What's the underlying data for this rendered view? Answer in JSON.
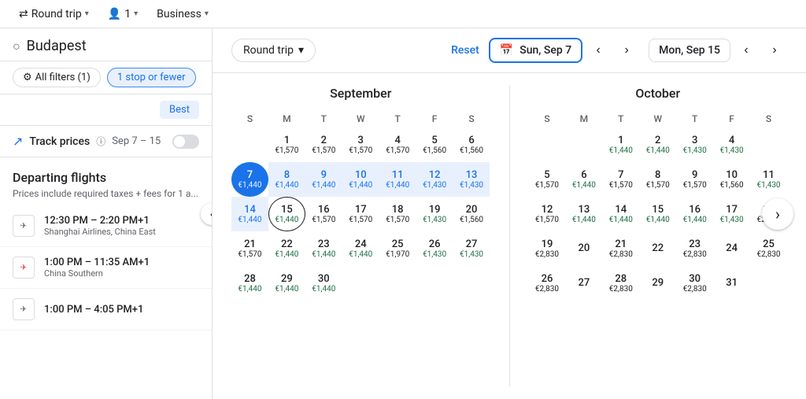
{
  "topbar": {
    "trip_type": "Round trip",
    "passengers": "1",
    "cabin": "Business",
    "chevron": "▾"
  },
  "left": {
    "search_placeholder": "Budapest",
    "filter_all": "All filters (1)",
    "filter_stops": "1 stop or fewer",
    "sort_label": "Best",
    "track_label": "Track prices",
    "track_info_icon": "ⓘ",
    "track_dates": "Sep 7 – 15",
    "departing_title": "Departing flights",
    "departing_sub": "Prices include required taxes + fees for 1 a...",
    "flights": [
      {
        "times": "12:30 PM – 2:20 PM+1",
        "airline": "Shanghai Airlines, China East"
      },
      {
        "times": "1:00 PM – 11:35 AM+1",
        "airline": "China Southern"
      },
      {
        "times": "1:00 PM – 4:05 PM+1",
        "airline": ""
      }
    ]
  },
  "calendar": {
    "trip_selector": "Round trip",
    "reset_label": "Reset",
    "selected_date": "Sun, Sep 7",
    "end_date": "Mon, Sep 15",
    "calendar_icon": "📅",
    "september": {
      "title": "September",
      "headers": [
        "S",
        "M",
        "T",
        "W",
        "T",
        "F",
        "S"
      ],
      "rows": [
        [
          {
            "day": "",
            "price": ""
          },
          {
            "day": "1",
            "price": "€1,570",
            "type": "normal"
          },
          {
            "day": "2",
            "price": "€1,570",
            "type": "normal"
          },
          {
            "day": "3",
            "price": "€1,570",
            "type": "normal"
          },
          {
            "day": "4",
            "price": "€1,570",
            "type": "normal"
          },
          {
            "day": "5",
            "price": "€1,560",
            "type": "normal"
          },
          {
            "day": "6",
            "price": "€1,560",
            "type": "normal"
          }
        ],
        [
          {
            "day": "7",
            "price": "€1,440",
            "type": "selected"
          },
          {
            "day": "8",
            "price": "€1,440",
            "type": "range"
          },
          {
            "day": "9",
            "price": "€1,440",
            "type": "range"
          },
          {
            "day": "10",
            "price": "€1,440",
            "type": "range"
          },
          {
            "day": "11",
            "price": "€1,440",
            "type": "range"
          },
          {
            "day": "12",
            "price": "€1,430",
            "type": "range"
          },
          {
            "day": "13",
            "price": "€1,430",
            "type": "range"
          }
        ],
        [
          {
            "day": "14",
            "price": "€1,440",
            "type": "range"
          },
          {
            "day": "15",
            "price": "€1,440",
            "type": "range-end"
          },
          {
            "day": "16",
            "price": "€1,570",
            "type": "normal"
          },
          {
            "day": "17",
            "price": "€1,570",
            "type": "normal"
          },
          {
            "day": "18",
            "price": "€1,570",
            "type": "normal"
          },
          {
            "day": "19",
            "price": "€1,430",
            "type": "green"
          },
          {
            "day": "20",
            "price": "€1,560",
            "type": "normal"
          }
        ],
        [
          {
            "day": "21",
            "price": "€1,570",
            "type": "normal"
          },
          {
            "day": "22",
            "price": "€1,440",
            "type": "green"
          },
          {
            "day": "23",
            "price": "€1,440",
            "type": "green"
          },
          {
            "day": "24",
            "price": "€1,440",
            "type": "green"
          },
          {
            "day": "25",
            "price": "€1,970",
            "type": "normal"
          },
          {
            "day": "26",
            "price": "€1,430",
            "type": "green"
          },
          {
            "day": "27",
            "price": "€1,430",
            "type": "green"
          }
        ],
        [
          {
            "day": "28",
            "price": "€1,440",
            "type": "green"
          },
          {
            "day": "29",
            "price": "€1,440",
            "type": "green"
          },
          {
            "day": "30",
            "price": "€1,440",
            "type": "green"
          },
          {
            "day": "",
            "price": ""
          },
          {
            "day": "",
            "price": ""
          },
          {
            "day": "",
            "price": ""
          },
          {
            "day": "",
            "price": ""
          }
        ]
      ]
    },
    "october": {
      "title": "October",
      "headers": [
        "S",
        "M",
        "T",
        "W",
        "T",
        "F",
        "S"
      ],
      "rows": [
        [
          {
            "day": "",
            "price": ""
          },
          {
            "day": "",
            "price": ""
          },
          {
            "day": "1",
            "price": "€1,440",
            "type": "green"
          },
          {
            "day": "2",
            "price": "€1,440",
            "type": "green"
          },
          {
            "day": "3",
            "price": "€1,430",
            "type": "green"
          },
          {
            "day": "4",
            "price": "€1,430",
            "type": "green"
          },
          {
            "day": "",
            "price": ""
          }
        ],
        [
          {
            "day": "5",
            "price": "€1,570",
            "type": "normal"
          },
          {
            "day": "6",
            "price": "€1,440",
            "type": "green"
          },
          {
            "day": "7",
            "price": "€1,570",
            "type": "normal"
          },
          {
            "day": "8",
            "price": "€1,570",
            "type": "normal"
          },
          {
            "day": "9",
            "price": "€1,570",
            "type": "normal"
          },
          {
            "day": "10",
            "price": "€1,560",
            "type": "normal"
          },
          {
            "day": "11",
            "price": "€1,430",
            "type": "green"
          }
        ],
        [
          {
            "day": "12",
            "price": "€1,570",
            "type": "normal"
          },
          {
            "day": "13",
            "price": "€1,440",
            "type": "green"
          },
          {
            "day": "14",
            "price": "€1,440",
            "type": "green"
          },
          {
            "day": "15",
            "price": "€1,440",
            "type": "green"
          },
          {
            "day": "16",
            "price": "€1,440",
            "type": "green"
          },
          {
            "day": "17",
            "price": "€1,430",
            "type": "green"
          },
          {
            "day": "18",
            "price": "€2,830",
            "type": "normal"
          }
        ],
        [
          {
            "day": "19",
            "price": "€2,830",
            "type": "normal"
          },
          {
            "day": "20",
            "price": "",
            "type": "normal"
          },
          {
            "day": "21",
            "price": "€2,830",
            "type": "normal"
          },
          {
            "day": "22",
            "price": "",
            "type": "normal"
          },
          {
            "day": "23",
            "price": "€2,830",
            "type": "normal"
          },
          {
            "day": "24",
            "price": "",
            "type": "normal"
          },
          {
            "day": "25",
            "price": "€2,830",
            "type": "normal"
          }
        ],
        [
          {
            "day": "26",
            "price": "€2,830",
            "type": "normal"
          },
          {
            "day": "27",
            "price": "",
            "type": "normal"
          },
          {
            "day": "28",
            "price": "€2,830",
            "type": "normal"
          },
          {
            "day": "29",
            "price": "",
            "type": "normal"
          },
          {
            "day": "30",
            "price": "€2,830",
            "type": "normal"
          },
          {
            "day": "31",
            "price": "",
            "type": "normal"
          },
          {
            "day": "",
            "price": ""
          }
        ]
      ]
    }
  }
}
